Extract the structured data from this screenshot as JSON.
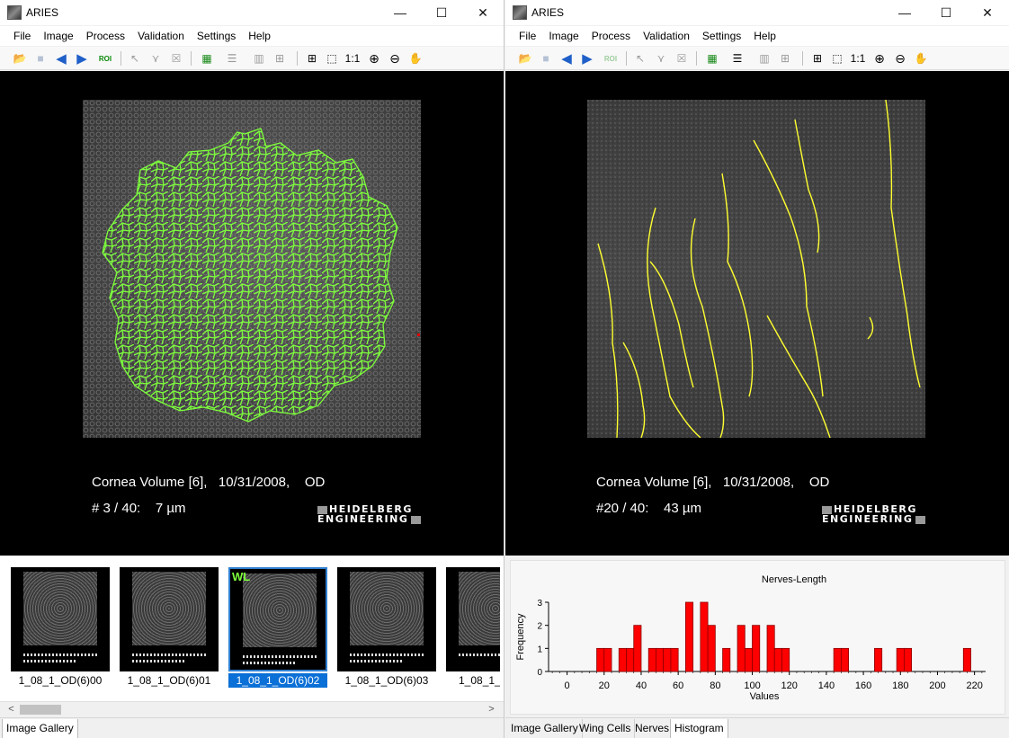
{
  "left": {
    "title": "ARIES",
    "controls": {
      "minimize": "—",
      "maximize": "☐",
      "close": "✕"
    },
    "menu": [
      "File",
      "Image",
      "Process",
      "Validation",
      "Settings",
      "Help"
    ],
    "toolbar": {
      "roi_label": "ROI",
      "zoom_1to1": "1:1"
    },
    "viewer": {
      "caption": "Cornea Volume [6],   10/31/2008,    OD",
      "slice": "# 3 / 40:    7 µm",
      "logo_line1": "HEIDELBERG",
      "logo_line2": "ENGINEERING"
    },
    "gallery": {
      "thumbnails": [
        {
          "label": "1_08_1_OD(6)00",
          "badge": "",
          "selected": false
        },
        {
          "label": "1_08_1_OD(6)01",
          "badge": "",
          "selected": false
        },
        {
          "label": "1_08_1_OD(6)02",
          "badge": "WL",
          "selected": true
        },
        {
          "label": "1_08_1_OD(6)03",
          "badge": "",
          "selected": false
        },
        {
          "label": "1_08_1_",
          "badge": "",
          "selected": false
        }
      ],
      "scroll_left": "<",
      "scroll_right": ">"
    },
    "tabs": [
      "Image Gallery"
    ]
  },
  "right": {
    "title": "ARIES",
    "controls": {
      "minimize": "—",
      "maximize": "☐",
      "close": "✕"
    },
    "menu": [
      "File",
      "Image",
      "Process",
      "Validation",
      "Settings",
      "Help"
    ],
    "toolbar": {
      "roi_label": "ROI",
      "zoom_1to1": "1:1"
    },
    "viewer": {
      "caption": "Cornea Volume [6],   10/31/2008,    OD",
      "slice": "#20 / 40:    43 µm",
      "logo_line1": "HEIDELBERG",
      "logo_line2": "ENGINEERING"
    },
    "tabs": [
      "Image Gallery",
      "Wing Cells",
      "Nerves",
      "Histogram"
    ],
    "active_tab": "Histogram"
  },
  "chart_data": {
    "type": "bar",
    "title": "Nerves-Length",
    "xlabel": "Values",
    "ylabel": "Frequency",
    "xlim": [
      -10,
      226
    ],
    "ylim": [
      0,
      3
    ],
    "bar_color": "#ff0000",
    "xticks": [
      0,
      20,
      40,
      60,
      80,
      100,
      120,
      140,
      160,
      180,
      200,
      220
    ],
    "yticks": [
      0,
      1,
      2,
      3
    ],
    "bins": [
      {
        "x": 18,
        "value": 1
      },
      {
        "x": 22,
        "value": 1
      },
      {
        "x": 30,
        "value": 1
      },
      {
        "x": 34,
        "value": 1
      },
      {
        "x": 38,
        "value": 2
      },
      {
        "x": 46,
        "value": 1
      },
      {
        "x": 50,
        "value": 1
      },
      {
        "x": 54,
        "value": 1
      },
      {
        "x": 58,
        "value": 1
      },
      {
        "x": 66,
        "value": 3
      },
      {
        "x": 74,
        "value": 3
      },
      {
        "x": 78,
        "value": 2
      },
      {
        "x": 86,
        "value": 1
      },
      {
        "x": 94,
        "value": 2
      },
      {
        "x": 98,
        "value": 1
      },
      {
        "x": 102,
        "value": 2
      },
      {
        "x": 110,
        "value": 2
      },
      {
        "x": 114,
        "value": 1
      },
      {
        "x": 118,
        "value": 1
      },
      {
        "x": 146,
        "value": 1
      },
      {
        "x": 150,
        "value": 1
      },
      {
        "x": 168,
        "value": 1
      },
      {
        "x": 180,
        "value": 1
      },
      {
        "x": 184,
        "value": 1
      },
      {
        "x": 216,
        "value": 1
      }
    ],
    "bin_width": 4
  }
}
